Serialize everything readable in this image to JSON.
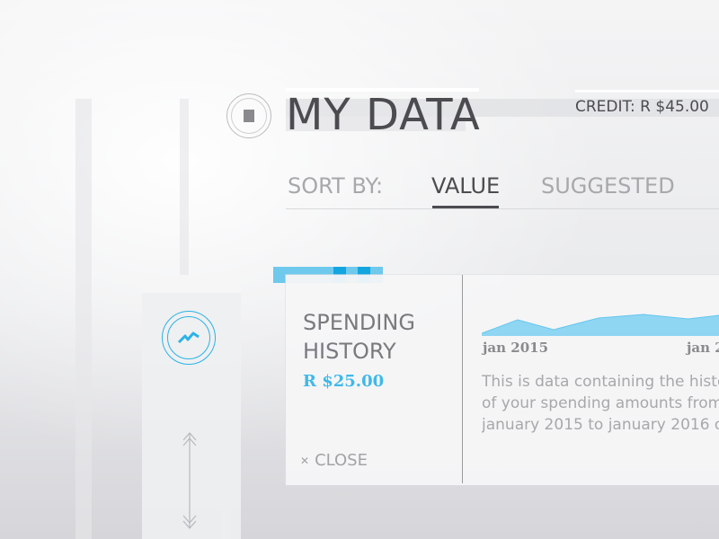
{
  "header": {
    "title": "MY DATA",
    "credit": "CREDIT: R $45.00",
    "app_icon": "square-stop-icon"
  },
  "sort": {
    "label": "SORT BY:",
    "options": [
      "VALUE",
      "SUGGESTED"
    ],
    "selected": "VALUE"
  },
  "card": {
    "category_icon": "trend-zigzag-icon",
    "title_line1": "SPENDING",
    "title_line2": "HISTORY",
    "price": "R $25.00",
    "close_label": "CLOSE",
    "close_icon": "close-icon",
    "chart_dates": [
      "jan 2015",
      "jan 2"
    ],
    "description_lines": [
      "This is data containing the histo",
      "of your spending amounts from",
      "january 2015 to january 2016 or"
    ]
  },
  "colors": {
    "accent": "#2bb3e6",
    "tab_light": "#6ec9ec",
    "tab_dark": "#12a5e0",
    "text_dark": "#4c4c50",
    "text_muted": "#a8a8ac"
  }
}
